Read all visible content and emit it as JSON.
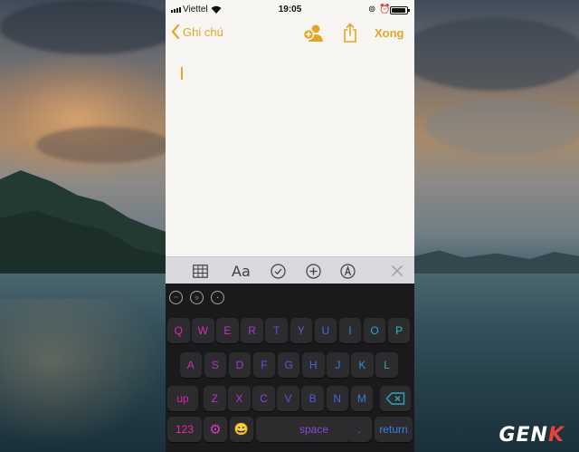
{
  "status_bar": {
    "carrier": "Viettel",
    "time": "19:05"
  },
  "navbar": {
    "back_label": "Ghi chú",
    "done_label": "Xong",
    "accent": "#e2a72a"
  },
  "note": {
    "text": ""
  },
  "toolbar": {
    "format_label": "Aa"
  },
  "keyboard": {
    "row1": [
      "Q",
      "W",
      "E",
      "R",
      "T",
      "Y",
      "U",
      "I",
      "O",
      "P"
    ],
    "row2": [
      "A",
      "S",
      "D",
      "F",
      "G",
      "H",
      "J",
      "K",
      "L"
    ],
    "row3": [
      "Z",
      "X",
      "C",
      "V",
      "B",
      "N",
      "M"
    ],
    "shift_label": "up",
    "numbers_label": "123",
    "space_label": "space",
    "period_label": ".",
    "return_label": "return",
    "emoji": "😀",
    "key_colors": {
      "row1": [
        "#e02aa9",
        "#d62fb8",
        "#c233c6",
        "#a13ad1",
        "#7d45da",
        "#5b57e0",
        "#3f6fe0",
        "#2c8bd8",
        "#27a6c9",
        "#2bbcb3"
      ],
      "row2": [
        "#d02aab",
        "#b734c2",
        "#9a3dd0",
        "#7a48da",
        "#5a55df",
        "#4267e0",
        "#307dda",
        "#2894cf",
        "#2aa8be"
      ],
      "row3": [
        "#c032c0",
        "#a83bcb",
        "#8c44d4",
        "#6f4edb",
        "#5659de",
        "#4467df",
        "#357bd9"
      ],
      "shift": "#d02aa8",
      "numbers": "#e02aa9",
      "settings": "#d23ab8",
      "space": "#8a49d6",
      "period": "#3f6fe0",
      "return": "#3b7ee4",
      "delete": "#2ba8c0"
    }
  },
  "watermark": {
    "brand_main": "GEN",
    "brand_accent": "K"
  }
}
